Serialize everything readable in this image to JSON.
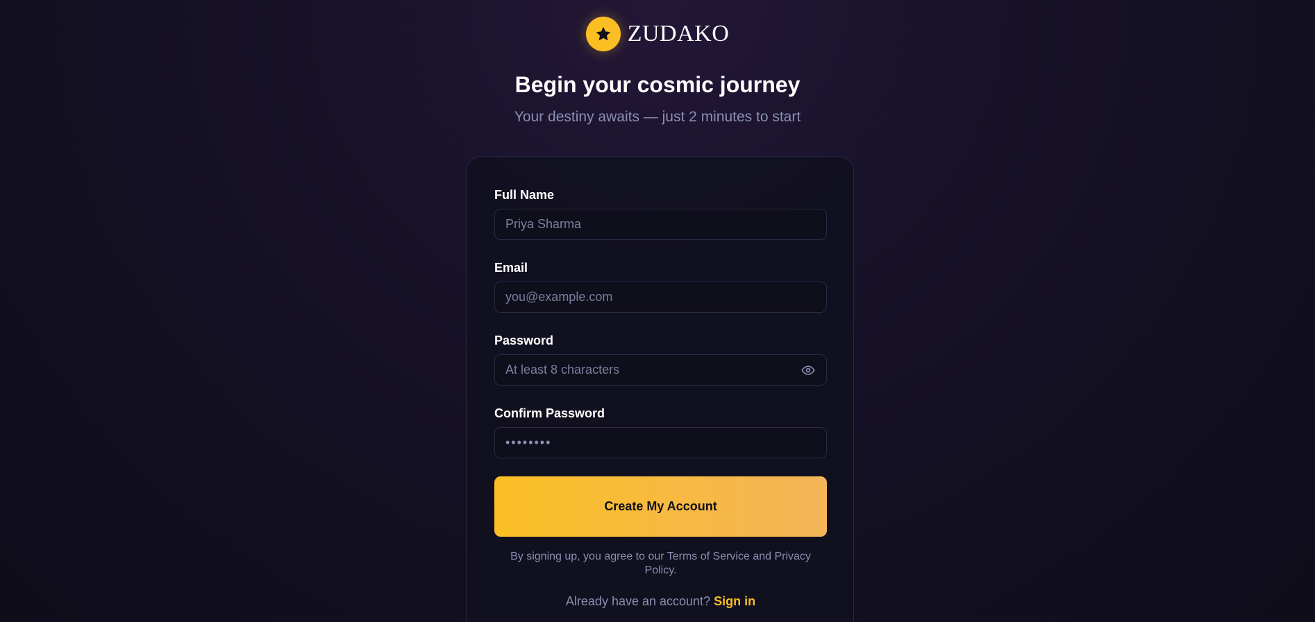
{
  "brand": {
    "name": "ZUDAKO",
    "icon": "star-icon",
    "color": "#fbbf24"
  },
  "header": {
    "title": "Begin your cosmic journey",
    "subtitle": "Your destiny awaits — just 2 minutes to start"
  },
  "form": {
    "full_name": {
      "label": "Full Name",
      "placeholder": "Priya Sharma",
      "value": ""
    },
    "email": {
      "label": "Email",
      "placeholder": "you@example.com",
      "value": ""
    },
    "password": {
      "label": "Password",
      "placeholder": "At least 8 characters",
      "value": "",
      "toggle_icon": "eye-icon"
    },
    "confirm_password": {
      "label": "Confirm Password",
      "masked_value": "••••••••"
    },
    "submit_label": "Create My Account",
    "terms_text": "By signing up, you agree to our Terms of Service and Privacy Policy.",
    "signin_prompt": "Already have an account?",
    "signin_link": "Sign in"
  },
  "colors": {
    "accent": "#fbbf24",
    "muted_text": "#8a8fb3",
    "background": "#120f20"
  }
}
